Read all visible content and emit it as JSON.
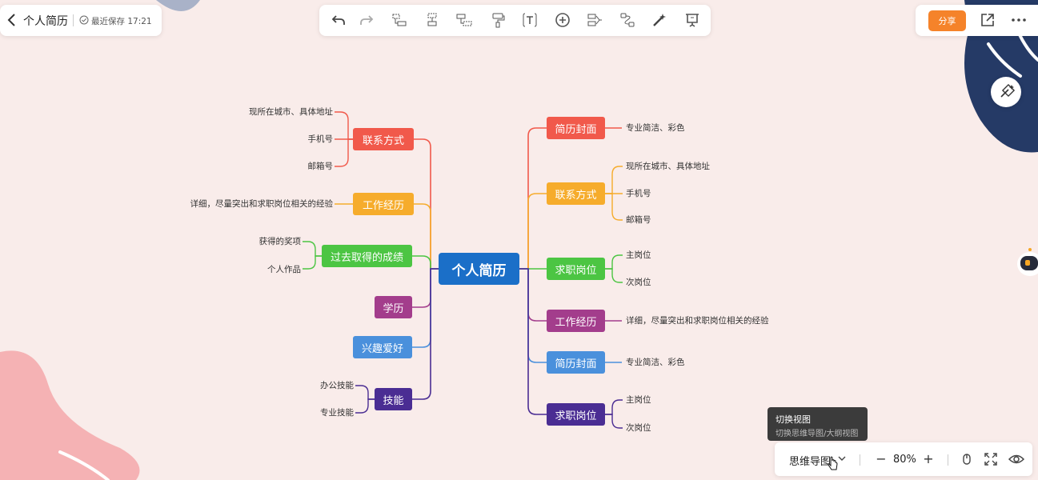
{
  "header": {
    "doc_title": "个人简历",
    "save_status": "最近保存 17:21"
  },
  "toolbar": {
    "tools": [
      "undo-icon",
      "redo-icon",
      "insert-sibling-icon",
      "insert-parent-icon",
      "insert-child-icon",
      "format-painter-icon",
      "text-icon",
      "add-icon",
      "summary-icon",
      "relation-icon",
      "style-icon",
      "presentation-icon"
    ]
  },
  "actions": {
    "share_label": "分享"
  },
  "mindmap": {
    "root": "个人简历",
    "left_nodes": [
      {
        "label": "联系方式",
        "color": "#f1594b",
        "leaves": [
          "现所在城市、具体地址",
          "手机号",
          "邮箱号"
        ]
      },
      {
        "label": "工作经历",
        "color": "#f6ac2c",
        "leaves": [
          "详细，尽量突出和求职岗位相关的经验"
        ]
      },
      {
        "label": "过去取得的成绩",
        "color": "#4cc543",
        "leaves": [
          "获得的奖项",
          "个人作品"
        ]
      },
      {
        "label": "学历",
        "color": "#a33d8c",
        "leaves": []
      },
      {
        "label": "兴趣爱好",
        "color": "#4a90dc",
        "leaves": []
      },
      {
        "label": "技能",
        "color": "#4a2d93",
        "leaves": [
          "办公技能",
          "专业技能"
        ]
      }
    ],
    "right_nodes": [
      {
        "label": "简历封面",
        "color": "#f1594b",
        "leaves": [
          "专业简洁、彩色"
        ]
      },
      {
        "label": "联系方式",
        "color": "#f6ac2c",
        "leaves": [
          "现所在城市、具体地址",
          "手机号",
          "邮箱号"
        ]
      },
      {
        "label": "求职岗位",
        "color": "#4cc543",
        "leaves": [
          "主岗位",
          "次岗位"
        ]
      },
      {
        "label": "工作经历",
        "color": "#a33d8c",
        "leaves": [
          "详细，尽量突出和求职岗位相关的经验"
        ]
      },
      {
        "label": "简历封面",
        "color": "#4a90dc",
        "leaves": [
          "专业简洁、彩色"
        ]
      },
      {
        "label": "求职岗位",
        "color": "#4a2d93",
        "leaves": [
          "主岗位",
          "次岗位"
        ]
      }
    ],
    "root_color": "#1b6fc8"
  },
  "tooltip": {
    "title": "切换视图",
    "desc": "切换思维导图/大纲视图"
  },
  "bottom_bar": {
    "view_label": "思维导图",
    "zoom": "80%",
    "zoom_out": "−",
    "zoom_in": "+"
  }
}
